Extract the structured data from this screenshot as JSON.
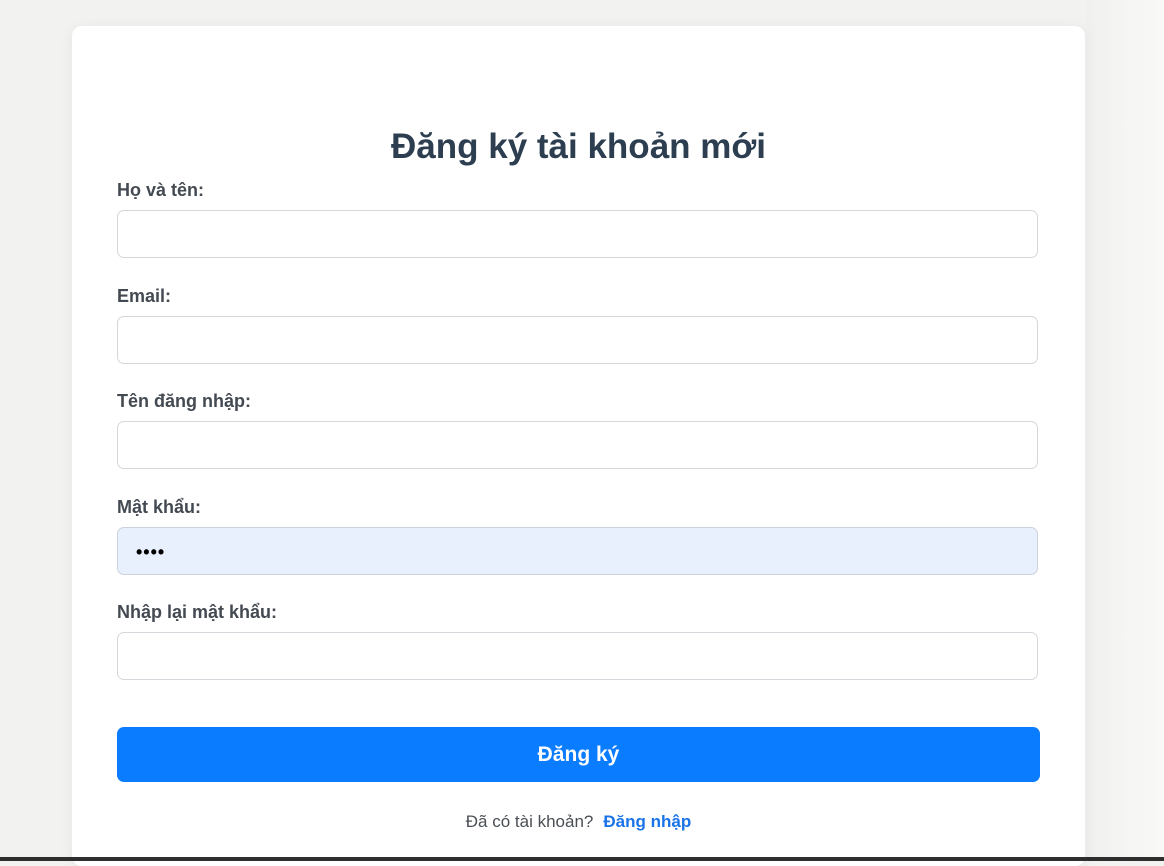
{
  "form": {
    "title": "Đăng ký tài khoản mới",
    "fields": [
      {
        "label": "Họ và tên:",
        "value": ""
      },
      {
        "label": "Email:",
        "value": ""
      },
      {
        "label": "Tên đăng nhập:",
        "value": ""
      },
      {
        "label": "Mật khẩu:",
        "value": "••••"
      },
      {
        "label": "Nhập lại mật khẩu:",
        "value": ""
      }
    ],
    "submit_label": "Đăng ký",
    "footer_text": "Đã có tài khoản?",
    "login_link": "Đăng nhập"
  },
  "colors": {
    "button": "#0a7cff",
    "title": "#2c3e50",
    "link": "#1a73e8",
    "autofill": "#e8f0fe"
  }
}
